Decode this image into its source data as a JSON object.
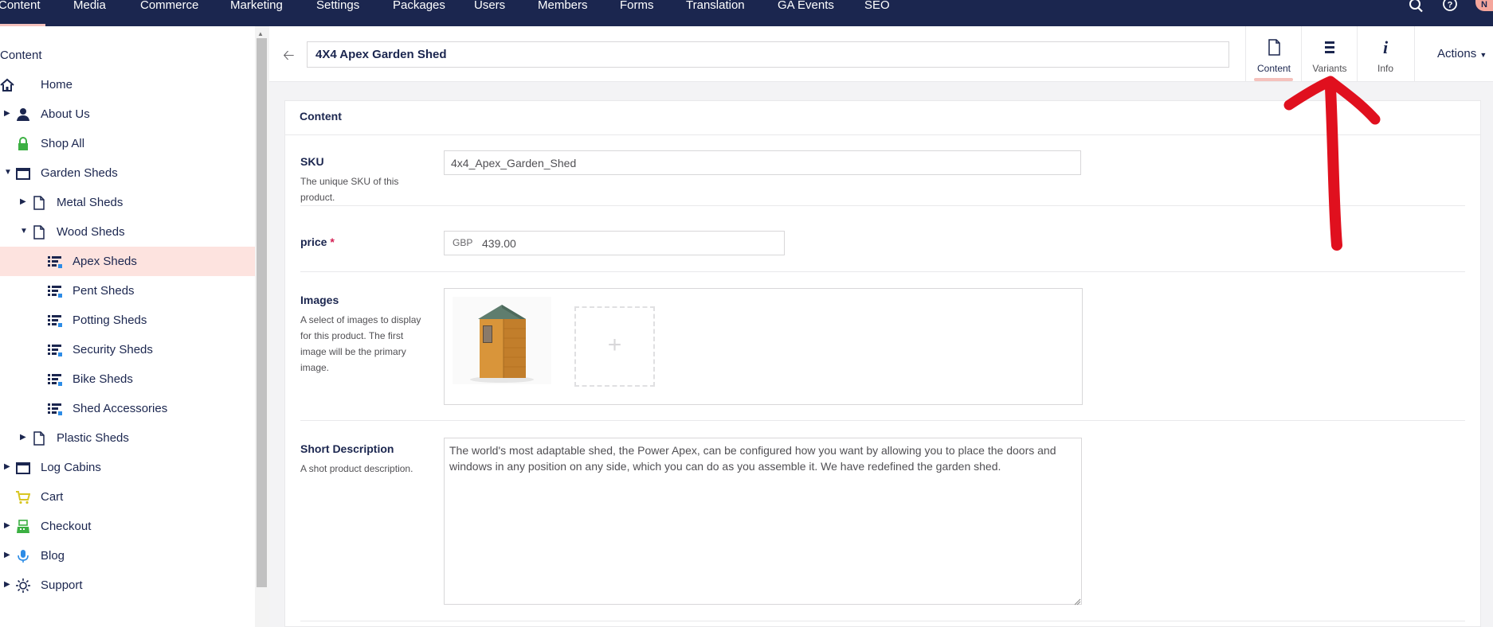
{
  "top_nav": {
    "sections": [
      {
        "label": "Content",
        "active": true
      },
      {
        "label": "Media",
        "active": false
      },
      {
        "label": "Commerce",
        "active": false
      },
      {
        "label": "Marketing",
        "active": false
      },
      {
        "label": "Settings",
        "active": false
      },
      {
        "label": "Packages",
        "active": false
      },
      {
        "label": "Users",
        "active": false
      },
      {
        "label": "Members",
        "active": false
      },
      {
        "label": "Forms",
        "active": false
      },
      {
        "label": "Translation",
        "active": false
      },
      {
        "label": "GA Events",
        "active": false
      },
      {
        "label": "SEO",
        "active": false
      }
    ],
    "search_icon": "search-icon",
    "help_icon": "help-icon",
    "avatar_initial": "N"
  },
  "sidebar": {
    "title": "Content",
    "items": [
      {
        "label": "Home",
        "icon": "home-icon"
      },
      {
        "label": "About Us",
        "icon": "user-icon"
      },
      {
        "label": "Shop All",
        "icon": "lock-icon"
      },
      {
        "label": "Garden Sheds",
        "icon": "window-icon"
      },
      {
        "label": "Metal Sheds",
        "icon": "document-icon"
      },
      {
        "label": "Wood Sheds",
        "icon": "document-icon"
      },
      {
        "label": "Apex Sheds",
        "icon": "product-list-icon",
        "selected": true
      },
      {
        "label": "Pent Sheds",
        "icon": "product-list-icon"
      },
      {
        "label": "Potting Sheds",
        "icon": "product-list-icon"
      },
      {
        "label": "Security Sheds",
        "icon": "product-list-icon"
      },
      {
        "label": "Bike Sheds",
        "icon": "product-list-icon"
      },
      {
        "label": "Shed Accessories",
        "icon": "product-list-icon"
      },
      {
        "label": "Plastic Sheds",
        "icon": "document-icon"
      },
      {
        "label": "Log Cabins",
        "icon": "window-icon"
      },
      {
        "label": "Cart",
        "icon": "cart-icon"
      },
      {
        "label": "Checkout",
        "icon": "register-icon"
      },
      {
        "label": "Blog",
        "icon": "microphone-icon"
      },
      {
        "label": "Support",
        "icon": "sun-icon"
      }
    ]
  },
  "editor": {
    "node_name": "4X4 Apex Garden Shed",
    "tabs": [
      {
        "label": "Content",
        "icon": "document-icon",
        "active": true
      },
      {
        "label": "Variants",
        "icon": "list-icon",
        "active": false
      },
      {
        "label": "Info",
        "icon": "info-icon",
        "active": false
      }
    ],
    "actions_label": "Actions",
    "panel_title": "Content",
    "properties": {
      "sku": {
        "label": "SKU",
        "description": "The unique SKU of this product.",
        "value": "4x4_Apex_Garden_Shed"
      },
      "price": {
        "label": "price",
        "required_marker": "*",
        "currency": "GBP",
        "value": "439.00"
      },
      "images": {
        "label": "Images",
        "description": "A select of images to display for this product. The first image will be the primary image.",
        "add_symbol": "+"
      },
      "short_description": {
        "label": "Short Description",
        "description": "A shot product description.",
        "value": "The world's most adaptable shed, the Power Apex, can be configured how you want by allowing you to place the doors and windows in any position on any side, which you can do as you assemble it. We have redefined the garden shed."
      }
    }
  },
  "colors": {
    "nav_bg": "#1b264f",
    "accent": "#f5c1bc",
    "selected_row": "#fde3df",
    "annotation_red": "#e0101e"
  }
}
